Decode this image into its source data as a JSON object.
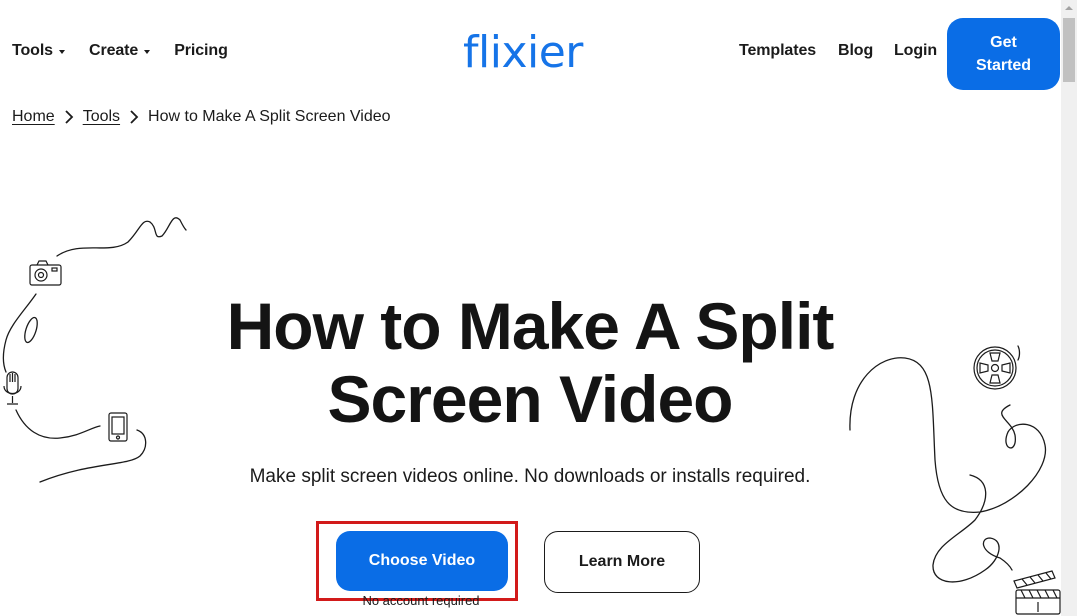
{
  "header": {
    "nav_left": [
      {
        "label": "Tools",
        "has_dropdown": true
      },
      {
        "label": "Create",
        "has_dropdown": true
      },
      {
        "label": "Pricing",
        "has_dropdown": false
      }
    ],
    "logo": "flixier",
    "nav_right": [
      {
        "label": "Templates"
      },
      {
        "label": "Blog"
      },
      {
        "label": "Login"
      }
    ],
    "cta": {
      "line1": "Get",
      "line2": "Started"
    }
  },
  "breadcrumb": {
    "items": [
      "Home",
      "Tools"
    ],
    "current": "How to Make A Split Screen Video"
  },
  "hero": {
    "title_line1": "How to Make A Split",
    "title_line2": "Screen Video",
    "subtitle": "Make split screen videos online. No downloads or installs required.",
    "primary_button": "Choose Video",
    "secondary_button": "Learn More",
    "note": "No account required"
  },
  "colors": {
    "brand": "#1674e8",
    "primary_button": "#0a6de6",
    "highlight": "#d21a1a",
    "text": "#1b1b1b"
  }
}
